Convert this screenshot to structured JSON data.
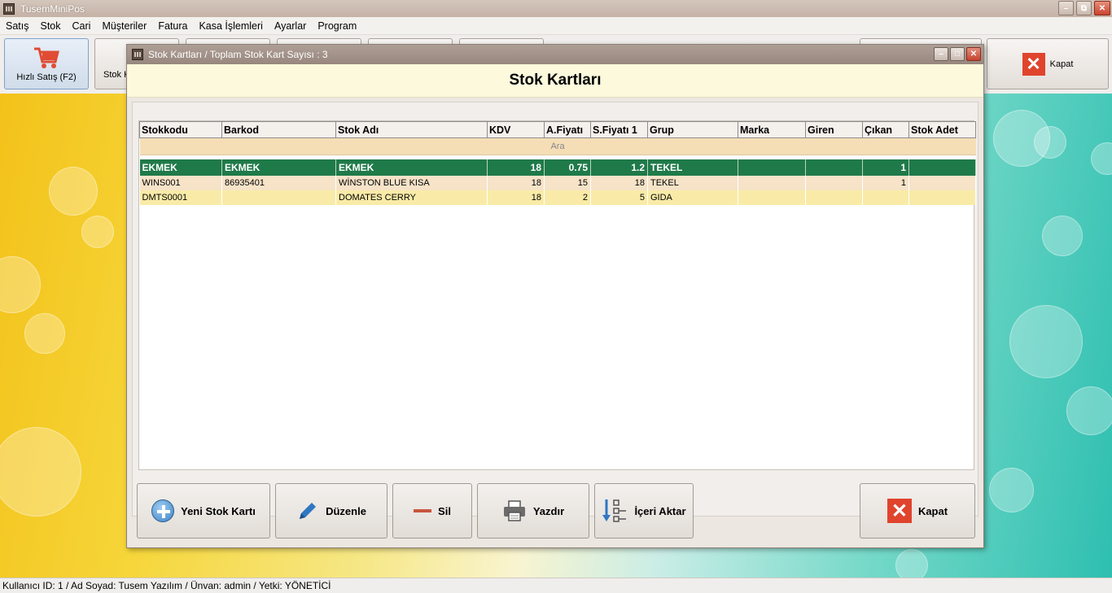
{
  "app": {
    "title": "TusemMiniPos",
    "window_buttons": {
      "minimize": "–",
      "restore": "⧉",
      "close": "✕"
    }
  },
  "menu": [
    "Satış",
    "Stok",
    "Cari",
    "Müşteriler",
    "Fatura",
    "Kasa İşlemleri",
    "Ayarlar",
    "Program"
  ],
  "toolbar": {
    "quick_sale_label": "Hızlı Satış (F2)",
    "stock_partial_label": "Stok K",
    "close_label": "Kapat"
  },
  "dialog": {
    "title": "Stok Kartları / Toplam Stok Kart Sayısı : 3",
    "header": "Stok Kartları",
    "grid": {
      "columns": [
        "Stokkodu",
        "Barkod",
        "Stok Adı",
        "KDV",
        "A.Fiyatı",
        "S.Fiyatı 1",
        "Grup",
        "Marka",
        "Giren",
        "Çıkan",
        "Stok Adet"
      ],
      "search_label": "Ara",
      "rows": [
        {
          "stokkodu": "EKMEK",
          "barkod": "EKMEK",
          "stok_adi": "EKMEK",
          "kdv": "18",
          "a_fiyati": "0.75",
          "s_fiyati": "1.2",
          "grup": "TEKEL",
          "marka": "",
          "giren": "",
          "cikan": "1",
          "stok_adet": ""
        },
        {
          "stokkodu": "WINS001",
          "barkod": "86935401",
          "stok_adi": "WİNSTON BLUE KISA",
          "kdv": "18",
          "a_fiyati": "15",
          "s_fiyati": "18",
          "grup": "TEKEL",
          "marka": "",
          "giren": "",
          "cikan": "1",
          "stok_adet": ""
        },
        {
          "stokkodu": "DMTS0001",
          "barkod": "",
          "stok_adi": "DOMATES CERRY",
          "kdv": "18",
          "a_fiyati": "2",
          "s_fiyati": "5",
          "grup": "GIDA",
          "marka": "",
          "giren": "",
          "cikan": "",
          "stok_adet": ""
        }
      ]
    },
    "buttons": {
      "new": "Yeni Stok Kartı",
      "edit": "Düzenle",
      "delete": "Sil",
      "print": "Yazdır",
      "import": "İçeri Aktar",
      "close": "Kapat"
    }
  },
  "status": "Kullanıcı ID: 1 / Ad Soyad: Tusem Yazılım / Ünvan: admin / Yetki: YÖNETİCİ",
  "colors": {
    "selected_row": "#1f7a49",
    "row_alt1": "#f6e3c8",
    "row_alt2": "#f9eba7",
    "search_row": "#f5deb6",
    "header_band": "#fcf9dc",
    "close_red": "#e0442d"
  }
}
